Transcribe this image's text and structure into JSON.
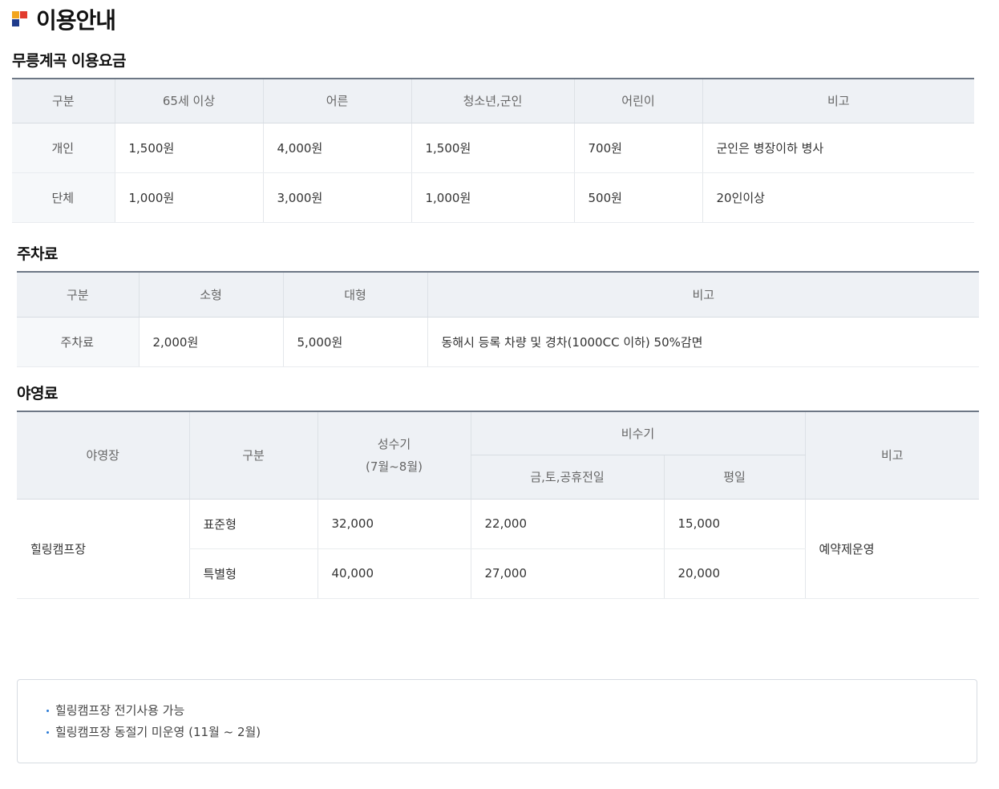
{
  "page": {
    "title": "이용안내"
  },
  "fee_section": {
    "title": "무릉계곡 이용요금",
    "headers": [
      "구분",
      "65세 이상",
      "어른",
      "청소년,군인",
      "어린이",
      "비고"
    ],
    "rows": [
      [
        "개인",
        "1,500원",
        "4,000원",
        "1,500원",
        "700원",
        "군인은 병장이하 병사"
      ],
      [
        "단체",
        "1,000원",
        "3,000원",
        "1,000원",
        "500원",
        "20인이상"
      ]
    ]
  },
  "parking_section": {
    "title": "주차료",
    "headers": [
      "구분",
      "소형",
      "대형",
      "비고"
    ],
    "rows": [
      [
        "주차료",
        "2,000원",
        "5,000원",
        "동해시 등록 차량 및 경차(1000CC 이하) 50%감면"
      ]
    ]
  },
  "camping_section": {
    "title": "야영료",
    "headers": {
      "site": "야영장",
      "type": "구분",
      "peak": "성수기",
      "peak_period": "(7월~8월)",
      "offpeak": "비수기",
      "offpeak_weekend": "금,토,공휴전일",
      "offpeak_weekday": "평일",
      "note": "비고"
    },
    "site_name": "힐링캠프장",
    "note_value": "예약제운영",
    "rows": [
      [
        "표준형",
        "32,000",
        "22,000",
        "15,000"
      ],
      [
        "특별형",
        "40,000",
        "27,000",
        "20,000"
      ]
    ]
  },
  "notice": {
    "items": [
      "힐링캠프장 전기사용 가능",
      "힐링캠프장 동절기 미운영 (11월 ~ 2월)"
    ]
  },
  "colors": {
    "header_bg": "#eef1f5",
    "header_top_border": "#6d7785",
    "bullet": "#2a7bd6",
    "icon_orange": "#f2a51e",
    "icon_red": "#e23b2e",
    "icon_navy": "#1f3b8c"
  }
}
